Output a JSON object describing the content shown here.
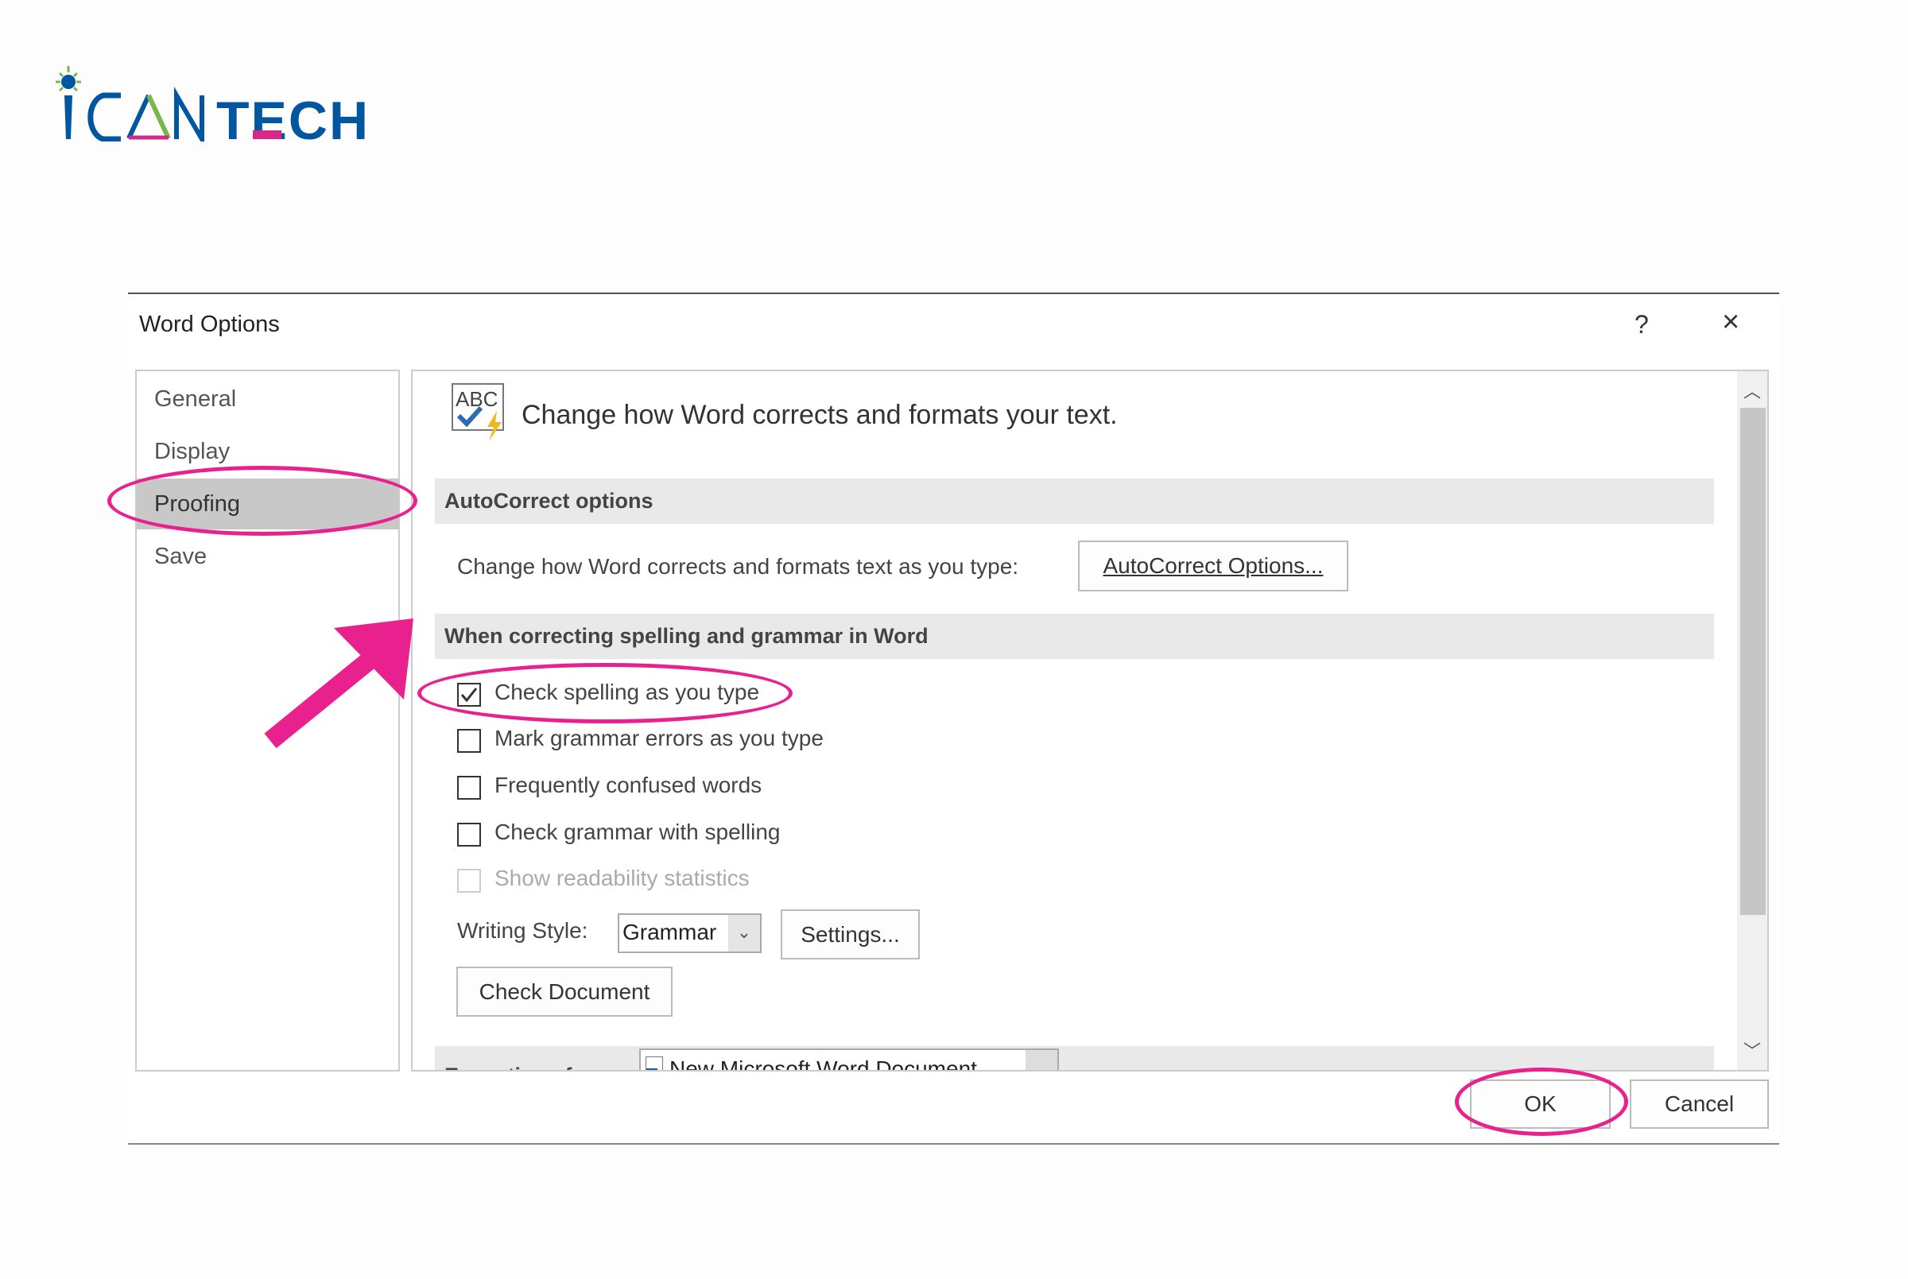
{
  "logo": {
    "text": "iCAN TECH",
    "colors": {
      "blue": "#0057a0",
      "pink": "#d6288a",
      "green": "#7ab648"
    }
  },
  "dialog": {
    "title": "Word Options",
    "help_icon": "?",
    "close_icon": "×",
    "nav": {
      "items": [
        {
          "label": "General"
        },
        {
          "label": "Display"
        },
        {
          "label": "Proofing",
          "selected": true
        },
        {
          "label": "Save"
        }
      ]
    },
    "header": {
      "icon": "abc-check-icon",
      "text": "Change how Word corrects and formats your text."
    },
    "autocorrect": {
      "section": "AutoCorrect options",
      "description": "Change how Word corrects and formats text as you type:",
      "button": "AutoCorrect Options..."
    },
    "spelling": {
      "section": "When correcting spelling and grammar in Word",
      "options": [
        {
          "label": "Check spelling as you type",
          "checked": true,
          "enabled": true
        },
        {
          "label": "Mark grammar errors as you type",
          "checked": false,
          "enabled": true
        },
        {
          "label": "Frequently confused words",
          "checked": false,
          "enabled": true
        },
        {
          "label": "Check grammar with spelling",
          "checked": false,
          "enabled": true
        },
        {
          "label": "Show readability statistics",
          "checked": false,
          "enabled": false
        }
      ],
      "writing_style_label": "Writing Style:",
      "writing_style_value": "Grammar",
      "settings_button": "Settings...",
      "check_document_button": "Check Document"
    },
    "exceptions": {
      "label": "Exceptions for:",
      "document": "New Microsoft Word Document"
    },
    "ok": "OK",
    "cancel": "Cancel"
  },
  "annotation_color": "#e8218e"
}
